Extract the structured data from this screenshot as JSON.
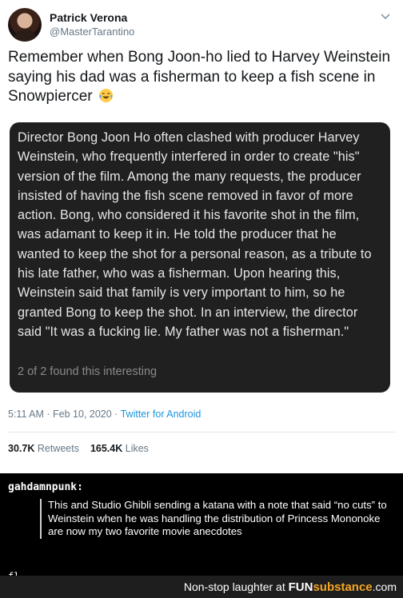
{
  "tweet": {
    "display_name": "Patrick Verona",
    "handle": "@MasterTarantino",
    "text": "Remember when Bong Joon-ho lied to Harvey Weinstein saying his dad was a fisherman to keep a fish scene in Snowpiercer",
    "emoji": "face-with-tears-of-joy",
    "card_text": "Director Bong Joon Ho often clashed with producer Harvey Weinstein, who frequently interfered in order to create \"his\" version of the film. Among the many requests, the producer insisted of having the fish scene removed in favor of more action. Bong, who considered it his favorite shot in the film, was adamant to keep it in. He told the producer that he wanted to keep the shot for a personal reason, as a tribute to his late father, who was a fisherman. Upon hearing this, Weinstein said that family is very important to him, so he granted Bong to keep the shot. In an interview, the director said \"It was a fucking lie. My father was not a fisherman.\"",
    "card_footer": "2 of 2 found this interesting",
    "timestamp": "5:11 AM · Feb 10, 2020 · ",
    "source": "Twitter for Android",
    "retweets_count": "30.7K",
    "retweets_label": "Retweets",
    "likes_count": "165.4K",
    "likes_label": "Likes"
  },
  "tumblr": {
    "username": "gahdamnpunk:",
    "quote": "This and Studio Ghibli sending a katana with a note that said “no cuts” to Weinstein when he was handling the distribution of Princess Mononoke are now my two favorite movie anecdotes",
    "cut_off": "fl"
  },
  "footer": {
    "text": "Non-stop laughter at ",
    "brand_fun": "FUN",
    "brand_sub": "substance",
    "brand_tld": ".com"
  },
  "colors": {
    "link": "#1b95e0",
    "card_bg": "#202020",
    "brand_accent": "#f5a623"
  }
}
